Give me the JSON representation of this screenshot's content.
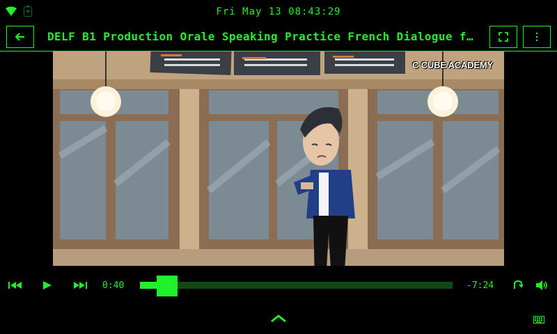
{
  "status": {
    "clock": "Fri May 13 08:43:29",
    "wifi_icon": "wifi-icon",
    "battery_icon": "battery-icon"
  },
  "header": {
    "title": "DELF B1 Production Orale Speaking Practice French Dialogue f…",
    "back_icon": "arrow-left-icon",
    "fullscreen_icon": "fullscreen-icon",
    "menu_icon": "more-vertical-icon"
  },
  "video": {
    "watermark": "C CUBE ACADEMY"
  },
  "player": {
    "elapsed": "0:40",
    "remaining": "-7:24",
    "progress": 0.08
  },
  "colors": {
    "accent": "#22f02a",
    "track": "#0c4a12",
    "background": "#000000"
  }
}
